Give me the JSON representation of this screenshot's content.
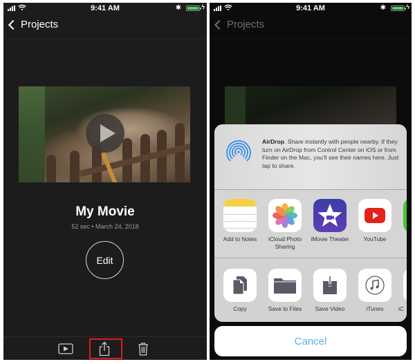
{
  "status_bar": {
    "time": "9:41 AM",
    "battery_level": 1.0,
    "charging": true,
    "bluetooth": true,
    "colors": {
      "battery_fill": "#4cd964"
    }
  },
  "left_screen": {
    "nav": {
      "back_label": "Projects"
    },
    "movie": {
      "title": "My Movie",
      "meta": "52 sec • March 24, 2018"
    },
    "edit_label": "Edit",
    "toolbar": {
      "items": [
        {
          "name": "play",
          "icon": "play-rectangle-icon"
        },
        {
          "name": "share",
          "icon": "share-icon",
          "highlighted": true
        },
        {
          "name": "delete",
          "icon": "trash-icon"
        }
      ],
      "highlight_color": "#e01b1b"
    }
  },
  "right_screen": {
    "nav": {
      "back_label": "Projects"
    },
    "share_sheet": {
      "airdrop": {
        "title": "AirDrop",
        "text": ". Share instantly with people nearby. If they turn on AirDrop from Control Center on iOS or from Finder on the Mac, you’ll see their names here. Just tap to share.",
        "icon": "airdrop-icon",
        "color": "#2f8ff0"
      },
      "apps": [
        {
          "label": "Add to Notes",
          "icon": "notes-icon"
        },
        {
          "label": "iCloud Photo Sharing",
          "icon": "photos-icon"
        },
        {
          "label": "iMovie Theater",
          "icon": "imovie-icon"
        },
        {
          "label": "YouTube",
          "icon": "youtube-icon"
        },
        {
          "label": "",
          "icon": "messages-icon"
        }
      ],
      "actions": [
        {
          "label": "Copy",
          "icon": "copy-icon"
        },
        {
          "label": "Save to Files",
          "icon": "folder-icon"
        },
        {
          "label": "Save Video",
          "icon": "save-video-icon"
        },
        {
          "label": "iTunes",
          "icon": "itunes-icon"
        },
        {
          "label": "iC",
          "icon": "icloud-icon"
        }
      ],
      "cancel_label": "Cancel",
      "cancel_color": "#5ab0e8"
    }
  }
}
